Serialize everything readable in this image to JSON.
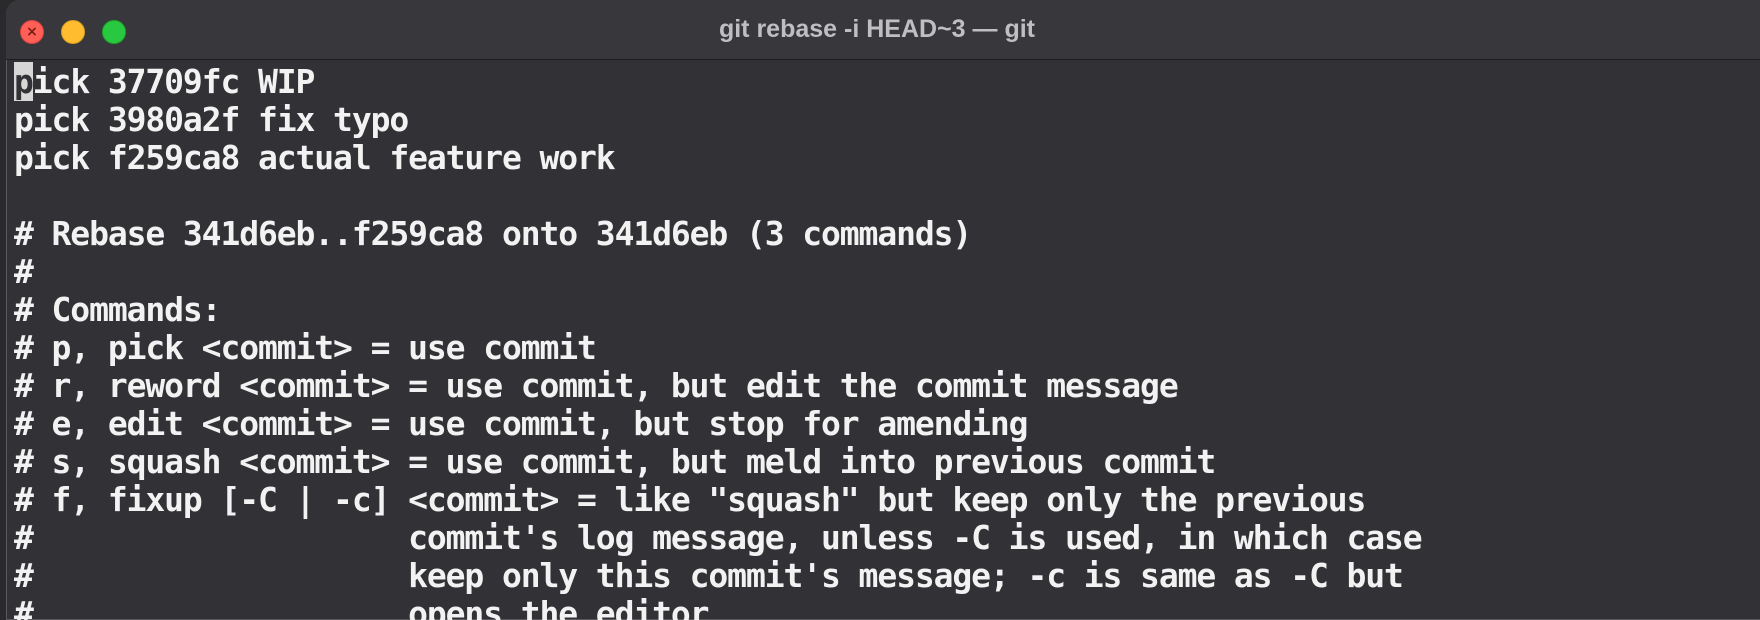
{
  "window": {
    "title": "git rebase -i HEAD~3 — git"
  },
  "terminal": {
    "cursor_char": "p",
    "lines": [
      "ick 37709fc WIP",
      "pick 3980a2f fix typo",
      "pick f259ca8 actual feature work",
      "",
      "# Rebase 341d6eb..f259ca8 onto 341d6eb (3 commands)",
      "#",
      "# Commands:",
      "# p, pick <commit> = use commit",
      "# r, reword <commit> = use commit, but edit the commit message",
      "# e, edit <commit> = use commit, but stop for amending",
      "# s, squash <commit> = use commit, but meld into previous commit",
      "# f, fixup [-C | -c] <commit> = like \"squash\" but keep only the previous",
      "#                    commit's log message, unless -C is used, in which case",
      "#                    keep only this commit's message; -c is same as -C but",
      "#                    opens the editor"
    ]
  }
}
